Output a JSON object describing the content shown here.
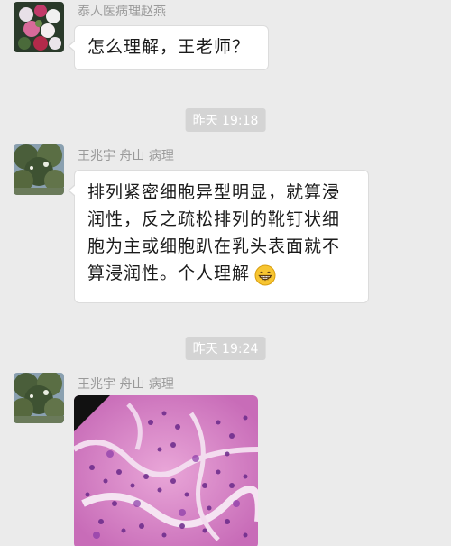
{
  "messages": [
    {
      "sender": "泰人医病理赵燕",
      "text": "怎么理解，王老师？"
    },
    {
      "sender": "王兆宇 舟山 病理",
      "text": "排列紧密细胞异型明显，就算浸润性，反之疏松排列的靴钉状细胞为主或细胞趴在乳头表面就不算浸润性。个人理解",
      "emoji": "grinning-face-emoji"
    },
    {
      "sender": "王兆宇 舟山 病理",
      "image": "histology-microscopy-image"
    }
  ],
  "timestamps": [
    {
      "label": "昨天 19:18"
    },
    {
      "label": "昨天 19:24"
    }
  ],
  "colors": {
    "background": "#ebebeb",
    "bubble": "#ffffff",
    "timestamp_bg": "#d4d4d4",
    "sender_text": "#9a9a9a"
  }
}
